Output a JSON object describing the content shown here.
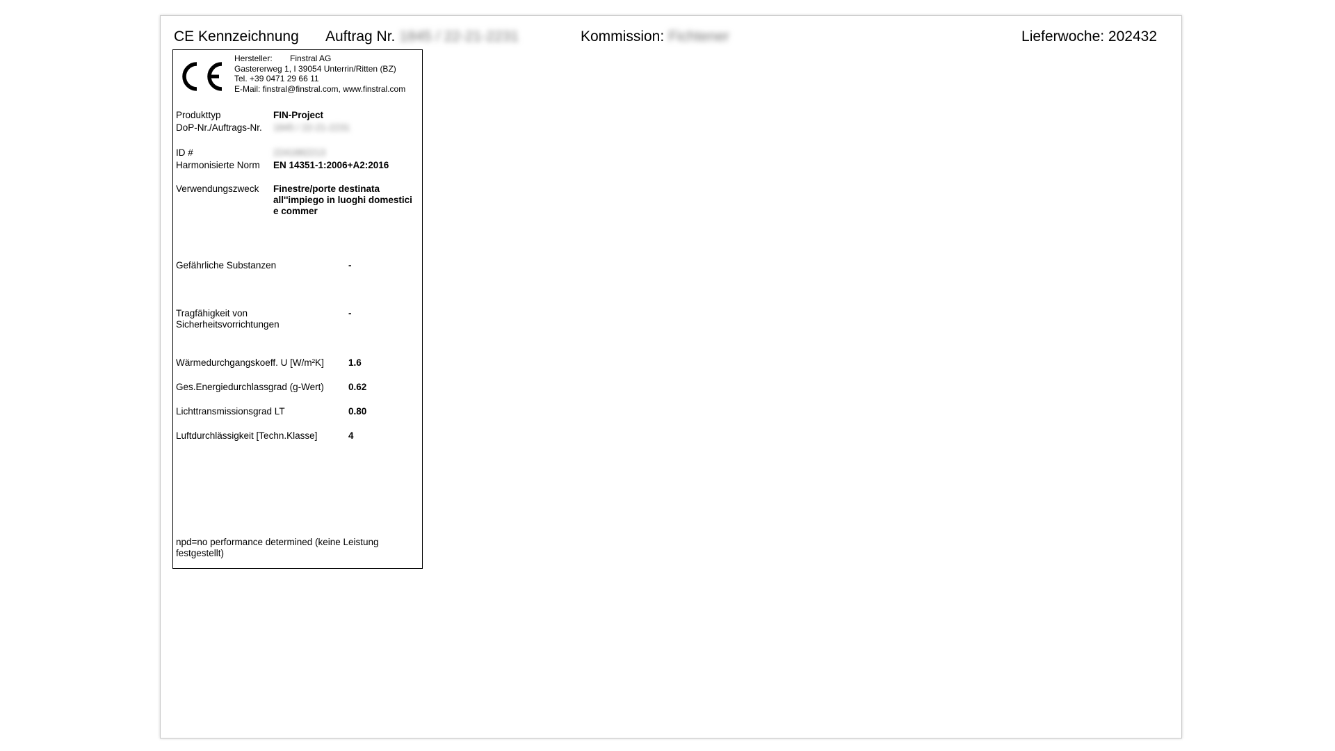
{
  "header": {
    "title": "CE Kennzeichnung",
    "auftrag_label": "Auftrag Nr.",
    "auftrag_value": "1845 / 22-21-2231",
    "kommission_label": "Kommission:",
    "kommission_value": "Fichtener",
    "lieferwoche": "Lieferwoche: 202432"
  },
  "label": {
    "ce_symbol": "CE",
    "manufacturer": {
      "hersteller_label": "Hersteller:",
      "hersteller_value": "Finstral AG",
      "address": "Gastererweg 1, I 39054 Unterrin/Ritten (BZ)",
      "phone": "Tel. +39 0471 29 66 11",
      "email": "E-Mail: finstral@finstral.com, www.finstral.com"
    },
    "produkttyp_label": "Produkttyp",
    "produkttyp_value": "FIN-Project",
    "dop_label": "DoP-Nr./Auftrags-Nr.",
    "dop_value": "1845 / 22-21-2231",
    "id_label": "ID #",
    "id_value": "2241882213",
    "norm_label": "Harmonisierte Norm",
    "norm_value": "EN 14351-1:2006+A2:2016",
    "verwendung_label": "Verwendungszweck",
    "verwendung_value": "Finestre/porte destinata all''impiego in luoghi domestici e commer",
    "substanzen_label": "Gefährliche Substanzen",
    "substanzen_value": "-",
    "tragfaehigkeit_label": "Tragfähigkeit von Sicherheitsvorrichtungen",
    "tragfaehigkeit_value": "-",
    "waerme_label": "Wärmedurchgangskoeff. U [W/m²K]",
    "waerme_value": "1.6",
    "energie_label": "Ges.Energiedurchlassgrad (g-Wert)",
    "energie_value": "0.62",
    "licht_label": "Lichttransmissionsgrad LT",
    "licht_value": "0.80",
    "luft_label": "Luftdurchlässigkeit [Techn.Klasse]",
    "luft_value": "4",
    "footnote": "npd=no performance determined (keine Leistung festgestellt)"
  }
}
